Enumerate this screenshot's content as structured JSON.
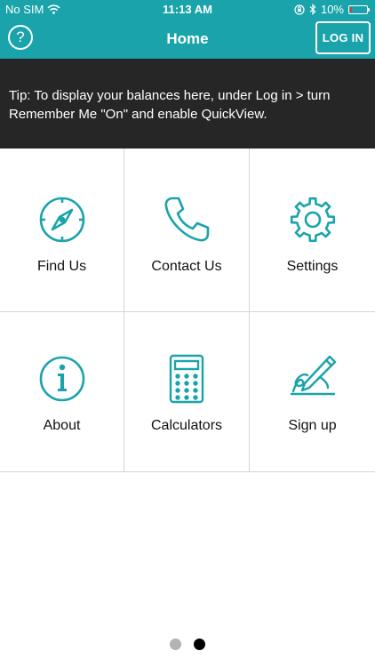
{
  "status_bar": {
    "carrier": "No SIM",
    "time": "11:13 AM",
    "battery_percent": "10%",
    "battery_level": 0.1
  },
  "nav": {
    "help_symbol": "?",
    "title": "Home",
    "login_label": "LOG IN"
  },
  "tip": {
    "text": "Tip: To display your balances here, under Log in > turn Remember Me \"On\" and enable QuickView."
  },
  "menu": [
    {
      "label": "Find Us",
      "icon": "compass-icon"
    },
    {
      "label": "Contact Us",
      "icon": "phone-icon"
    },
    {
      "label": "Settings",
      "icon": "gear-icon"
    },
    {
      "label": "About",
      "icon": "info-icon"
    },
    {
      "label": "Calculators",
      "icon": "calculator-icon"
    },
    {
      "label": "Sign up",
      "icon": "pen-signature-icon"
    }
  ],
  "colors": {
    "accent": "#1aa3ab",
    "tip_background": "#262626",
    "dot_inactive": "#b3b3b3",
    "dot_active": "#000000"
  },
  "page_indicator": {
    "count": 2,
    "active_index": 1
  }
}
